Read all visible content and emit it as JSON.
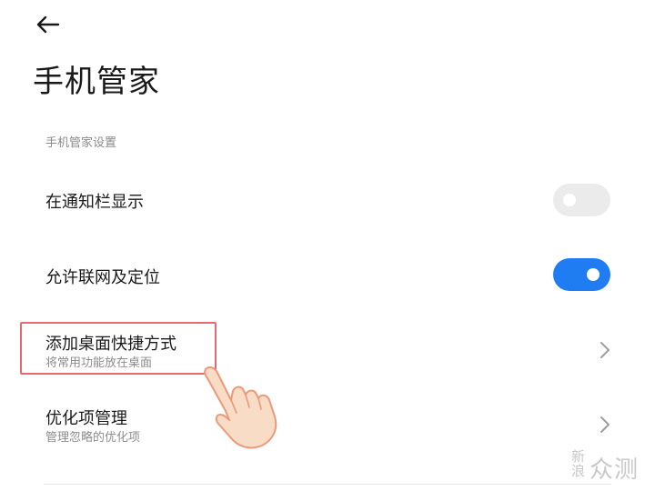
{
  "header": {
    "back_icon": "arrow-left-icon",
    "title": "手机管家"
  },
  "section": {
    "title": "手机管家设置"
  },
  "settings": [
    {
      "label": "在通知栏显示",
      "control": "toggle",
      "enabled": false
    },
    {
      "label": "允许联网及定位",
      "control": "toggle",
      "enabled": true
    },
    {
      "label": "添加桌面快捷方式",
      "subtitle": "将常用功能放在桌面",
      "control": "chevron",
      "highlighted": true
    },
    {
      "label": "优化项管理",
      "subtitle": "管理忽略的优化项",
      "control": "chevron"
    }
  ],
  "colors": {
    "accent": "#1f7cf2",
    "toggle_off": "#ebebeb",
    "highlight_border": "#e46a70"
  },
  "overlay": {
    "pointer_icon": "hand-pointer-icon"
  },
  "watermark": {
    "small": "新浪",
    "large": "众测"
  }
}
